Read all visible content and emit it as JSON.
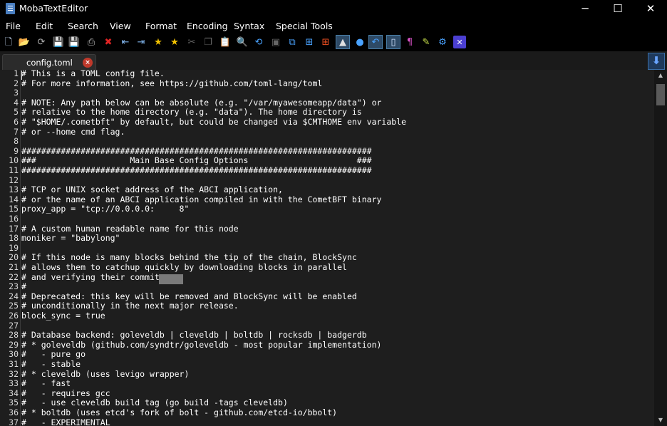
{
  "window": {
    "title": "MobaTextEditor",
    "minimize": "─",
    "maximize": "☐",
    "close": "✕"
  },
  "menu": [
    "File",
    "Edit",
    "Search",
    "View",
    "Format",
    "Encoding",
    "Syntax",
    "Special Tools"
  ],
  "toolbar": [
    {
      "name": "new-file-icon",
      "glyph": "🗋",
      "color": "#cfe3ff"
    },
    {
      "name": "open-folder-icon",
      "glyph": "📂",
      "color": "#f0b429"
    },
    {
      "name": "reload-icon",
      "glyph": "⟳",
      "color": "#b0b0b0"
    },
    {
      "name": "save-icon",
      "glyph": "💾",
      "color": "#9aa4b1"
    },
    {
      "name": "save-all-icon",
      "glyph": "💾",
      "color": "#9aa4b1"
    },
    {
      "name": "print-icon",
      "glyph": "⎙",
      "color": "#cccccc"
    },
    {
      "name": "close-file-icon",
      "glyph": "✖",
      "color": "#e02424"
    },
    {
      "name": "outdent-icon",
      "glyph": "⇤",
      "color": "#7fb2e8"
    },
    {
      "name": "indent-icon",
      "glyph": "⇥",
      "color": "#7fb2e8"
    },
    {
      "name": "bookmark-star-icon",
      "glyph": "★",
      "color": "#f2c200"
    },
    {
      "name": "favorite-star-icon",
      "glyph": "★",
      "color": "#f2c200"
    },
    {
      "name": "cut-icon",
      "glyph": "✂",
      "color": "#666666"
    },
    {
      "name": "copy-icon",
      "glyph": "❐",
      "color": "#666666"
    },
    {
      "name": "paste-icon",
      "glyph": "📋",
      "color": "#666666"
    },
    {
      "name": "find-icon",
      "glyph": "🔍",
      "color": "#9ec9ff"
    },
    {
      "name": "replace-icon",
      "glyph": "⟲",
      "color": "#4aa3ff"
    },
    {
      "name": "image-icon",
      "glyph": "▣",
      "color": "#666666"
    },
    {
      "name": "compare-icon",
      "glyph": "⧉",
      "color": "#4aa3ff"
    },
    {
      "name": "windows-icon",
      "glyph": "⊞",
      "color": "#4aa3ff"
    },
    {
      "name": "windows-flag-icon",
      "glyph": "⊞",
      "color": "#f25022"
    },
    {
      "name": "linux-icon",
      "glyph": "▲",
      "color": "#e0e0e0",
      "active": true
    },
    {
      "name": "apple-icon",
      "glyph": "●",
      "color": "#4aa3ff"
    },
    {
      "name": "undo-icon",
      "glyph": "↶",
      "color": "#4aa3ff",
      "active": true
    },
    {
      "name": "document-icon",
      "glyph": "▯",
      "color": "#cfe3ff",
      "active": true
    },
    {
      "name": "pilcrow-icon",
      "glyph": "¶",
      "color": "#d04fbf"
    },
    {
      "name": "highlighter-icon",
      "glyph": "✎",
      "color": "#c8e04a"
    },
    {
      "name": "settings-gears-icon",
      "glyph": "⚙",
      "color": "#4aa3ff"
    },
    {
      "name": "exit-icon",
      "glyph": "✕",
      "color": "#ffffff",
      "bg": "#4b3fd1"
    }
  ],
  "tab": {
    "label": "config.toml",
    "close": "×"
  },
  "scroll_down_button": "⬇",
  "scrollbar": {
    "up": "▲",
    "down": "▼"
  },
  "lines": [
    {
      "n": "1",
      "t": "# This is a TOML config file."
    },
    {
      "n": "2",
      "t": "# For more information, see https://github.com/toml-lang/toml"
    },
    {
      "n": "3",
      "t": ""
    },
    {
      "n": "4",
      "t": "# NOTE: Any path below can be absolute (e.g. \"/var/myawesomeapp/data\") or"
    },
    {
      "n": "5",
      "t": "# relative to the home directory (e.g. \"data\"). The home directory is"
    },
    {
      "n": "6",
      "t": "# \"$HOME/.cometbft\" by default, but could be changed via $CMTHOME env variable"
    },
    {
      "n": "7",
      "t": "# or --home cmd flag."
    },
    {
      "n": "8",
      "t": ""
    },
    {
      "n": "9",
      "t": "#######################################################################"
    },
    {
      "n": "10",
      "t": "###                   Main Base Config Options                      ###"
    },
    {
      "n": "11",
      "t": "#######################################################################"
    },
    {
      "n": "12",
      "t": ""
    },
    {
      "n": "13",
      "t": "# TCP or UNIX socket address of the ABCI application,"
    },
    {
      "n": "14",
      "t": "# or the name of an ABCI application compiled in with the CometBFT binary"
    },
    {
      "n": "15",
      "t": "proxy_app = \"tcp://0.0.0.0:     8\""
    },
    {
      "n": "16",
      "t": ""
    },
    {
      "n": "17",
      "t": "# A custom human readable name for this node"
    },
    {
      "n": "18",
      "t": "moniker = \"babylong\""
    },
    {
      "n": "19",
      "t": ""
    },
    {
      "n": "20",
      "t": "# If this node is many blocks behind the tip of the chain, BlockSync"
    },
    {
      "n": "21",
      "t": "# allows them to catchup quickly by downloading blocks in parallel"
    },
    {
      "n": "22",
      "t": "# and verifying their commits"
    },
    {
      "n": "23",
      "t": "#"
    },
    {
      "n": "24",
      "t": "# Deprecated: this key will be removed and BlockSync will be enabled"
    },
    {
      "n": "25",
      "t": "# unconditionally in the next major release."
    },
    {
      "n": "26",
      "t": "block_sync = true"
    },
    {
      "n": "27",
      "t": ""
    },
    {
      "n": "28",
      "t": "# Database backend: goleveldb | cleveldb | boltdb | rocksdb | badgerdb"
    },
    {
      "n": "29",
      "t": "# * goleveldb (github.com/syndtr/goleveldb - most popular implementation)"
    },
    {
      "n": "30",
      "t": "#   - pure go"
    },
    {
      "n": "31",
      "t": "#   - stable"
    },
    {
      "n": "32",
      "t": "# * cleveldb (uses levigo wrapper)"
    },
    {
      "n": "33",
      "t": "#   - fast"
    },
    {
      "n": "34",
      "t": "#   - requires gcc"
    },
    {
      "n": "35",
      "t": "#   - use cleveldb build tag (go build -tags cleveldb)"
    },
    {
      "n": "36",
      "t": "# * boltdb (uses etcd's fork of bolt - github.com/etcd-io/bbolt)"
    },
    {
      "n": "37",
      "t": "#   - EXPERIMENTAL"
    }
  ]
}
